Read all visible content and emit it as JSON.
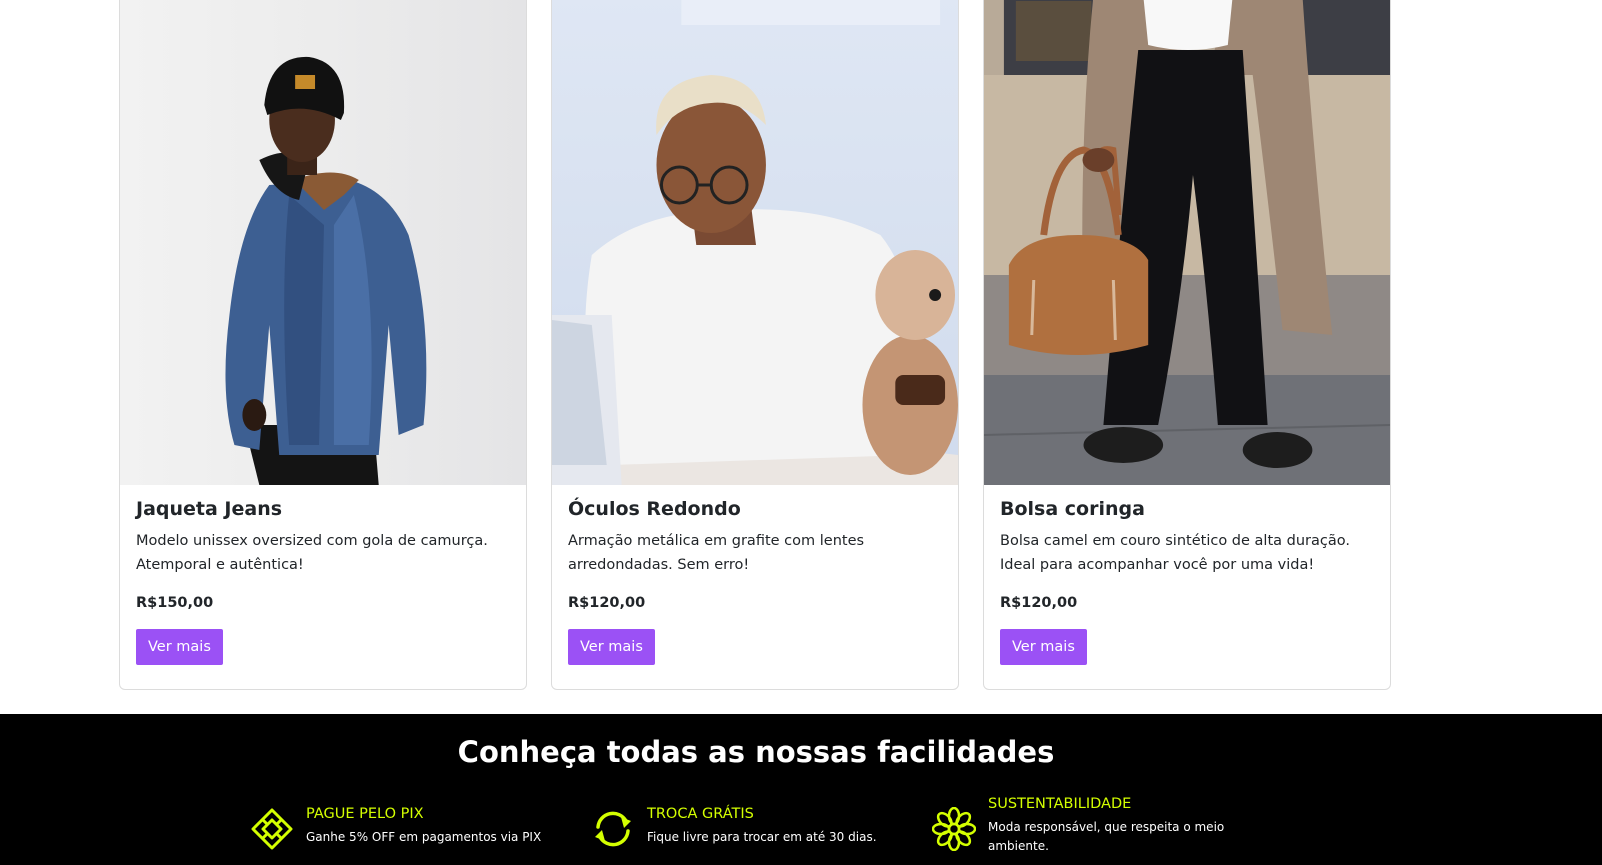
{
  "products": [
    {
      "title": "Jaqueta Jeans",
      "description": "Modelo unissex oversized com gola de camurça. Atemporal e autêntica!",
      "price": "R$150,00",
      "button_label": "Ver mais"
    },
    {
      "title": "Óculos Redondo",
      "description": "Armação metálica em grafite com lentes arredondadas. Sem erro!",
      "price": "R$120,00",
      "button_label": "Ver mais"
    },
    {
      "title": "Bolsa coringa",
      "description": "Bolsa camel em couro sintético de alta duração. Ideal para acompanhar você por uma vida!",
      "price": "R$120,00",
      "button_label": "Ver mais"
    }
  ],
  "footer": {
    "heading": "Conheça todas as nossas facilidades",
    "features": [
      {
        "icon": "diamond-grid-icon",
        "title": "PAGUE PELO PIX",
        "text": "Ganhe 5% OFF em pagamentos via PIX"
      },
      {
        "icon": "exchange-arrows-icon",
        "title": "TROCA GRÁTIS",
        "text": "Fique livre para trocar em até 30 dias."
      },
      {
        "icon": "flower-icon",
        "title": "SUSTENTABILIDADE",
        "text": "Moda responsável, que respeita o meio ambiente."
      }
    ]
  },
  "colors": {
    "button": "#9b51f5",
    "accent": "#d4ff00",
    "footer_bg": "#000000"
  }
}
